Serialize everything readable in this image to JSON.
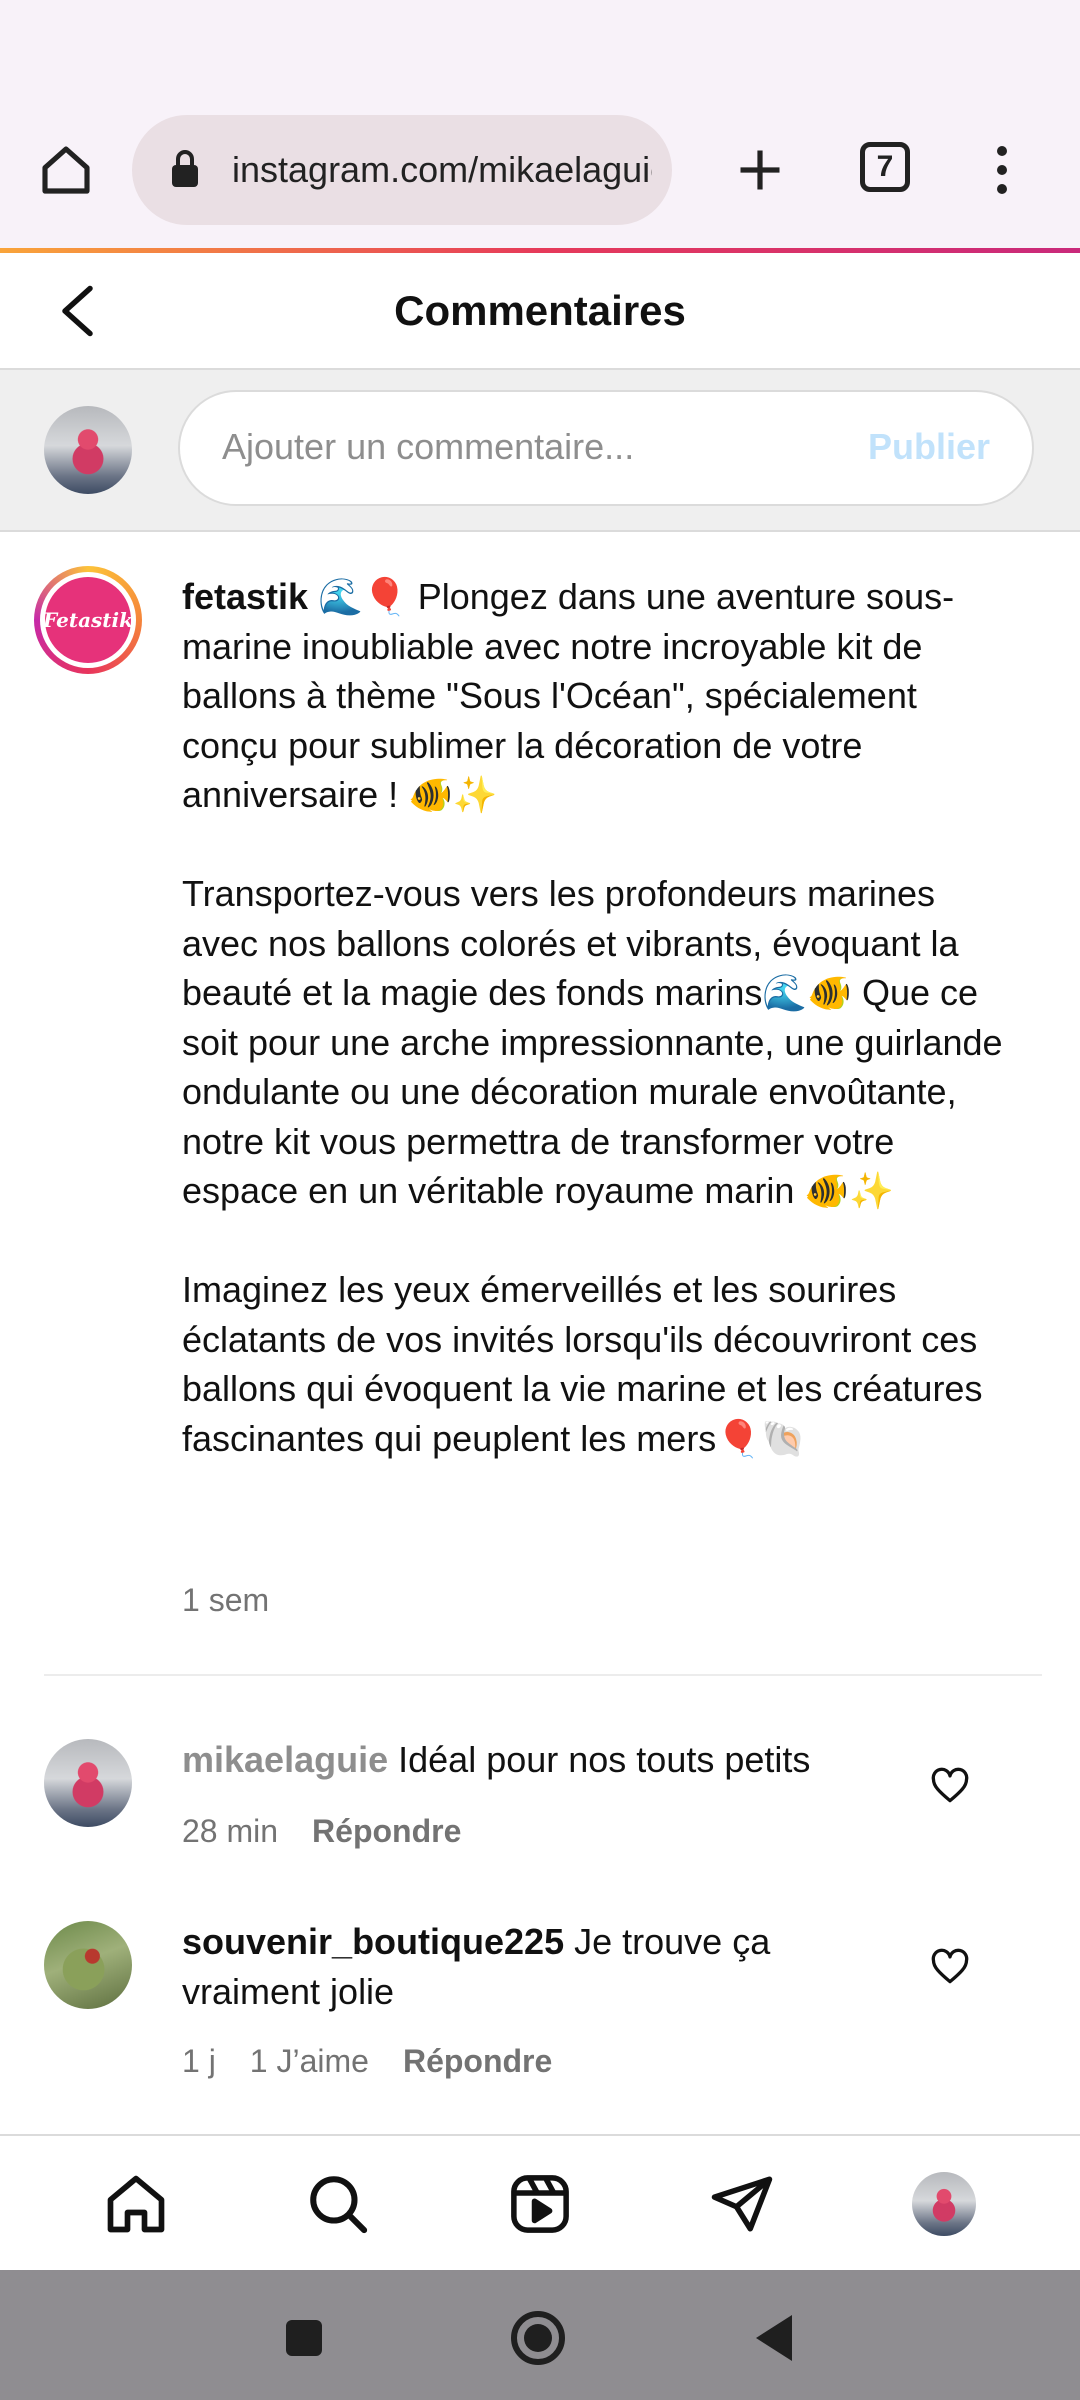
{
  "browser": {
    "url": "instagram.com/mikaelaguie",
    "tab_count": "7"
  },
  "header": {
    "title": "Commentaires"
  },
  "composer": {
    "placeholder": "Ajouter un commentaire...",
    "publish_label": "Publier"
  },
  "caption": {
    "username": "fetastik",
    "logo_text": "Fetastik",
    "paragraph1": "🌊🎈 Plongez dans une aventure sous-marine inoubliable avec notre incroyable kit de ballons à thème \"Sous l'Océan\", spécialement conçu pour sublimer la décoration de votre anniversaire ! 🐠✨",
    "paragraph2": "Transportez-vous vers les profondeurs marines avec nos ballons colorés et vibrants, évoquant la beauté et la magie des fonds marins🌊🐠 Que ce soit pour une arche impressionnante, une guirlande ondulante ou une décoration murale envoûtante, notre kit vous permettra de transformer votre espace en un véritable royaume marin 🐠✨",
    "paragraph3": "Imaginez les yeux émerveillés et les sourires éclatants de vos invités lorsqu'ils découvriront ces ballons qui évoquent la vie marine et les créatures fascinantes qui peuplent les mers🎈🐚",
    "age": "1 sem"
  },
  "comments": [
    {
      "username": "mikaelaguie",
      "text": "Idéal pour nos touts petits",
      "age": "28 min",
      "reply_label": "Répondre"
    },
    {
      "username": "souvenir_boutique225",
      "text": "Je trouve ça vraiment jolie",
      "age": "1 j",
      "likes": "1 J’aime",
      "reply_label": "Répondre"
    }
  ],
  "icons": {
    "browser": [
      "home-icon",
      "lock-icon",
      "plus-icon",
      "tabs-icon",
      "more-vert-icon"
    ],
    "header": [
      "back-chevron-icon"
    ],
    "comment": [
      "heart-icon"
    ],
    "bottom_nav": [
      "home-icon",
      "search-icon",
      "reels-icon",
      "direct-icon",
      "profile-avatar"
    ],
    "system_nav": [
      "recents-icon",
      "home-circle-icon",
      "back-triangle-icon"
    ]
  },
  "colors": {
    "accent_gradient": [
      "#f9a43a",
      "#e63a5a",
      "#c9297b"
    ],
    "publish_disabled": "#c1e2fb",
    "muted_text": "#737373",
    "logo_pink": "#e6327a"
  }
}
